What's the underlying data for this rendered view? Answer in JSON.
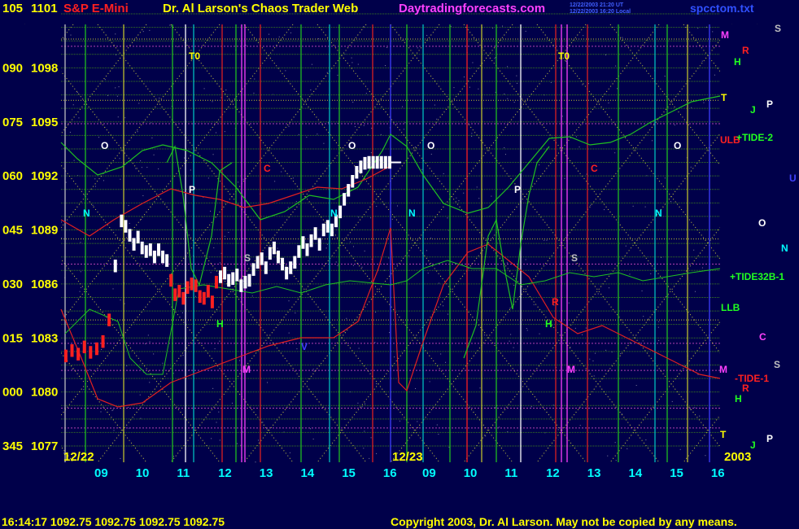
{
  "header": {
    "symbol": "S&P E-Mini",
    "title": "Dr. Al Larson's Chaos Trader Web",
    "site": "Daytradingforecasts.com",
    "timestamp_lines": [
      "12/22/2003 21:20 UT",
      "12/22/2003 16:20 Local"
    ],
    "file": "spcctom.txt"
  },
  "footer": {
    "quote": "16:14:17  1092.75 1092.75 1092.75 1092.75",
    "copyright": "Copyright 2003, Dr. Al Larson. May not be copied by any means."
  },
  "colors": {
    "background": "#00004a",
    "axis_text": "#ffff00",
    "price_bars": "#ffffff",
    "price_bars_early": "#ff2020",
    "curve_green": "#20c020",
    "curve_red": "#e02020",
    "x_labels": "#00ffff"
  },
  "chart_data": {
    "type": "bar",
    "title": "S&P E-Mini",
    "y_left_labels": [
      "105",
      "090",
      "075",
      "060",
      "045",
      "030",
      "015",
      "000",
      "345"
    ],
    "y_prices": [
      1101,
      1098,
      1095,
      1092,
      1089,
      1086,
      1083,
      1080,
      1077
    ],
    "ylim": [
      1077,
      1101
    ],
    "date_labels": [
      "12/22",
      "12/23",
      "2003"
    ],
    "hour_ticks": [
      "09",
      "10",
      "11",
      "12",
      "13",
      "14",
      "15",
      "16",
      "09",
      "10",
      "11",
      "12",
      "13",
      "14",
      "15",
      "16"
    ],
    "price_series": {
      "name": "S&P E-Mini",
      "x_hours": [
        8.15,
        8.3,
        8.45,
        8.6,
        8.75,
        8.9,
        9.05,
        9.2,
        9.35,
        9.5,
        9.6,
        9.7,
        9.8,
        9.9,
        10.0,
        10.1,
        10.2,
        10.3,
        10.4,
        10.5,
        10.6,
        10.7,
        10.8,
        10.9,
        11.0,
        11.1,
        11.2,
        11.3,
        11.4,
        11.5,
        11.6,
        11.7,
        11.8,
        11.9,
        12.0,
        12.1,
        12.2,
        12.3,
        12.4,
        12.5,
        12.6,
        12.7,
        12.8,
        12.9,
        13.0,
        13.1,
        13.2,
        13.3,
        13.4,
        13.5,
        13.6,
        13.7,
        13.8,
        13.9,
        14.0,
        14.1,
        14.2,
        14.3,
        14.4,
        14.5,
        14.6,
        14.7,
        14.8,
        14.9,
        15.0,
        15.1,
        15.2,
        15.3,
        15.4,
        15.5,
        15.6,
        15.7,
        15.8,
        15.9,
        16.0
      ],
      "close": [
        1082.0,
        1082.3,
        1082.1,
        1082.5,
        1082.2,
        1082.4,
        1082.8,
        1084.0,
        1087.0,
        1089.5,
        1089.2,
        1088.7,
        1088.2,
        1088.6,
        1088.0,
        1087.8,
        1087.9,
        1087.5,
        1087.9,
        1087.5,
        1087.3,
        1086.2,
        1085.4,
        1085.6,
        1085.2,
        1085.8,
        1086.0,
        1085.9,
        1085.3,
        1085.2,
        1085.6,
        1085.0,
        1086.1,
        1086.4,
        1086.6,
        1086.2,
        1086.3,
        1086.5,
        1085.9,
        1086.1,
        1086.2,
        1086.8,
        1087.2,
        1087.4,
        1086.9,
        1087.7,
        1088.0,
        1087.5,
        1087.1,
        1086.6,
        1086.9,
        1087.2,
        1087.8,
        1088.3,
        1087.9,
        1088.4,
        1088.8,
        1088.2,
        1089.0,
        1089.2,
        1089.0,
        1089.5,
        1090.0,
        1090.7,
        1091.2,
        1091.7,
        1092.2,
        1092.5,
        1092.7,
        1092.75,
        1092.75,
        1092.75,
        1092.75,
        1092.75,
        1092.75
      ]
    },
    "curve_labels": [
      {
        "text": "T0",
        "color": "#ffff00"
      },
      {
        "text": "T0",
        "color": "#ffff00"
      },
      {
        "text": "O",
        "color": "#ffffff"
      },
      {
        "text": "O",
        "color": "#ffffff"
      },
      {
        "text": "O",
        "color": "#ffffff"
      },
      {
        "text": "O",
        "color": "#ffffff"
      },
      {
        "text": "N",
        "color": "#00ffff"
      },
      {
        "text": "N",
        "color": "#00ffff"
      },
      {
        "text": "N",
        "color": "#00ffff"
      },
      {
        "text": "N",
        "color": "#00ffff"
      },
      {
        "text": "P",
        "color": "#ffffff"
      },
      {
        "text": "P",
        "color": "#ffffff"
      },
      {
        "text": "C",
        "color": "#ff2020"
      },
      {
        "text": "C",
        "color": "#ff2020"
      },
      {
        "text": "S",
        "color": "#c0c0c0"
      },
      {
        "text": "S",
        "color": "#c0c0c0"
      },
      {
        "text": "H",
        "color": "#20ff20"
      },
      {
        "text": "H",
        "color": "#20ff20"
      },
      {
        "text": "M",
        "color": "#ff40ff"
      },
      {
        "text": "M",
        "color": "#ff40ff"
      },
      {
        "text": "V",
        "color": "#4040ff"
      },
      {
        "text": "R",
        "color": "#ff2020"
      }
    ],
    "right_labels": [
      {
        "text": "M",
        "color": "#ff40ff"
      },
      {
        "text": "S",
        "color": "#c0c0c0"
      },
      {
        "text": "R",
        "color": "#ff2020"
      },
      {
        "text": "H",
        "color": "#20ff20"
      },
      {
        "text": "T",
        "color": "#ffff00"
      },
      {
        "text": "J",
        "color": "#20ff20"
      },
      {
        "text": "P",
        "color": "#ffffff"
      },
      {
        "text": "ULB",
        "color": "#ff2020"
      },
      {
        "text": "+TIDE-2",
        "color": "#20ff20"
      },
      {
        "text": "U",
        "color": "#4040ff"
      },
      {
        "text": "O",
        "color": "#ffffff"
      },
      {
        "text": "N",
        "color": "#00ffff"
      },
      {
        "text": "+TIDE32B-1",
        "color": "#20ff20"
      },
      {
        "text": "LLB",
        "color": "#20ff20"
      },
      {
        "text": "C",
        "color": "#ff40ff"
      },
      {
        "text": "S",
        "color": "#c0c0c0"
      },
      {
        "text": "M",
        "color": "#ff40ff"
      },
      {
        "text": "-TIDE-1",
        "color": "#ff2020"
      },
      {
        "text": "R",
        "color": "#ff2020"
      },
      {
        "text": "H",
        "color": "#20ff20"
      },
      {
        "text": "T",
        "color": "#ffff00"
      },
      {
        "text": "J",
        "color": "#20ff20"
      },
      {
        "text": "P",
        "color": "#ffffff"
      }
    ]
  }
}
